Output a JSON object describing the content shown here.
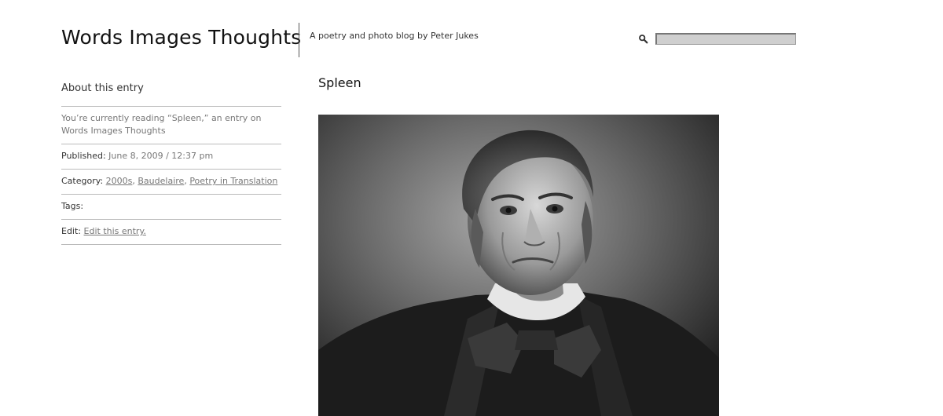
{
  "header": {
    "site_title": "Words Images Thoughts",
    "tagline": "A poetry and photo blog by Peter Jukes",
    "search_placeholder": ""
  },
  "sidebar": {
    "heading": "About this entry",
    "reading_text": "You’re currently reading “Spleen,” an entry on Words Images Thoughts",
    "published_label": "Published:",
    "published_value": "June 8, 2009 / 12:37 pm",
    "category_label": "Category:",
    "categories": [
      "2000s",
      "Baudelaire",
      "Poetry in Translation"
    ],
    "category_separator": ", ",
    "tags_label": "Tags:",
    "edit_label": "Edit:",
    "edit_link": "Edit this entry."
  },
  "post": {
    "title": "Spleen",
    "image_alt": "Black-and-white portrait photograph"
  },
  "colors": {
    "background": "#ffffff",
    "title_text": "#111111",
    "muted_text": "#777777",
    "divider": "#bbbbbb",
    "search_field": "#cfcfcf"
  }
}
